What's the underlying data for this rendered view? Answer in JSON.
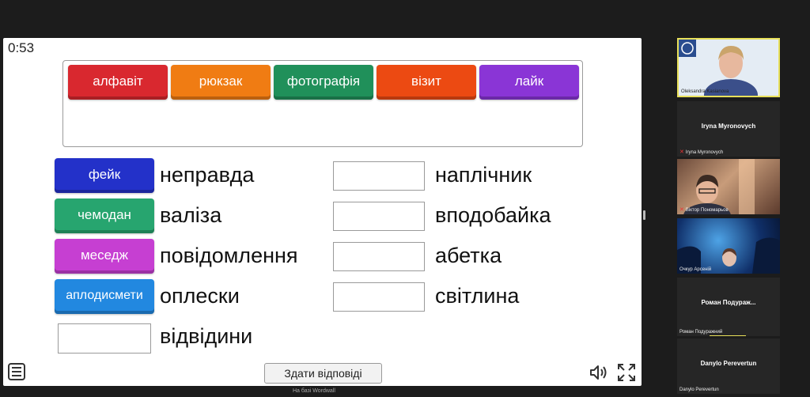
{
  "game": {
    "timer": "0:53",
    "tray_tiles": [
      {
        "label": "алфавіт",
        "color": "#d9282f"
      },
      {
        "label": "рюкзак",
        "color": "#f07c13"
      },
      {
        "label": "фотографія",
        "color": "#20905a"
      },
      {
        "label": "візит",
        "color": "#ec4a12"
      },
      {
        "label": "лайк",
        "color": "#8a35d6"
      }
    ],
    "left_column": [
      {
        "tile": "фейк",
        "tile_color": "#2331c9",
        "word": "неправда"
      },
      {
        "tile": "чемодан",
        "tile_color": "#27a56f",
        "word": "валіза"
      },
      {
        "tile": "меседж",
        "tile_color": "#c63fd2",
        "word": "повідомлення"
      },
      {
        "tile": "аплодисмети",
        "tile_color": "#2288e0",
        "word": "оплески"
      },
      {
        "tile": "",
        "tile_color": "",
        "word": "відвідини"
      }
    ],
    "right_column": [
      {
        "word": "наплічник"
      },
      {
        "word": "вподобайка"
      },
      {
        "word": "абетка"
      },
      {
        "word": "світлина"
      }
    ],
    "submit_label": "Здати відповіді",
    "footer_text": "На базі Wordwall"
  },
  "participants": [
    {
      "name": "Oleksandra Kasianova",
      "active_speaker": true
    },
    {
      "name": "Iryna Myronovych",
      "big_name": "Iryna Myronovych",
      "muted": true
    },
    {
      "name": "Віктор Пономарьов",
      "muted": true
    },
    {
      "name": "Очкур Арсеній"
    },
    {
      "name": "Роман Подуражний",
      "big_name": "Роман Подураж..."
    },
    {
      "name": "Danylo Perevertun",
      "big_name": "Danylo Perevertun"
    }
  ]
}
